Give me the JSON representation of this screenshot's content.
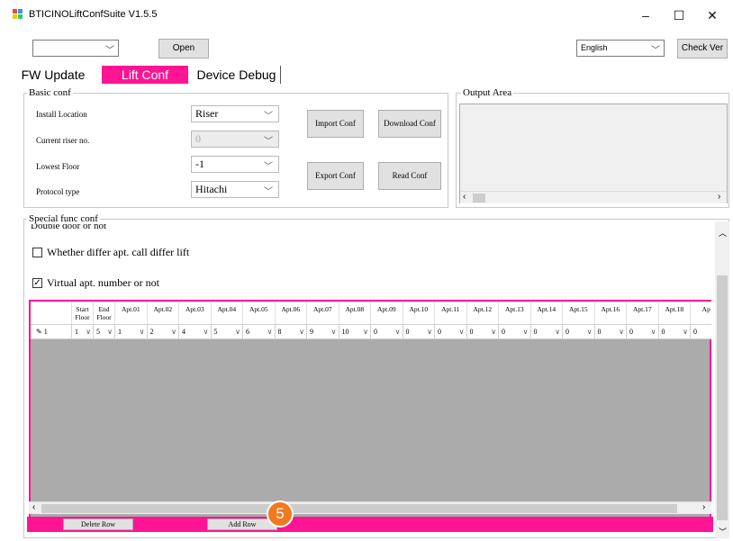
{
  "window": {
    "title": "BTICINOLiftConfSuite V1.5.5",
    "minimize": "–",
    "maximize": "☐",
    "close": "✕"
  },
  "toolbar": {
    "port_value": "",
    "open_label": "Open",
    "language_value": "English",
    "check_ver_label": "Check Ver"
  },
  "tabs": [
    {
      "label": "FW Update"
    },
    {
      "label": "Lift Conf"
    },
    {
      "label": "Device Debug"
    }
  ],
  "basic_conf": {
    "title": "Basic conf",
    "install_location": {
      "label": "Install Location",
      "value": "Riser"
    },
    "current_riser": {
      "label": "Current riser no.",
      "value": "0"
    },
    "lowest_floor": {
      "label": "Lowest Floor",
      "value": "-1"
    },
    "protocol_type": {
      "label": "Protocol type",
      "value": "Hitachi"
    },
    "import_label": "Import Conf",
    "download_label": "Download Conf",
    "export_label": "Export Conf",
    "read_label": "Read Conf"
  },
  "output_area": {
    "title": "Output Area"
  },
  "special_conf": {
    "title": "Special func conf",
    "partial_text": "Double door or not",
    "option1": {
      "label": "Whether differ apt. call differ lift",
      "checked": false
    },
    "option2": {
      "label": "Virtual apt. number or not",
      "checked": true
    }
  },
  "grid": {
    "columns": [
      "",
      "Start Floor",
      "End Floor",
      "Apt.01",
      "Apt.02",
      "Apt.03",
      "Apt.04",
      "Apt.05",
      "Apt.06",
      "Apt.07",
      "Apt.08",
      "Apt.09",
      "Apt.10",
      "Apt.11",
      "Apt.12",
      "Apt.13",
      "Apt.14",
      "Apt.15",
      "Apt.16",
      "Apt.17",
      "Apt.18",
      "Ap"
    ],
    "row": {
      "marker": "✎ 1",
      "values": [
        "1",
        "5",
        "1",
        "2",
        "4",
        "5",
        "6",
        "8",
        "9",
        "10",
        "0",
        "0",
        "0",
        "0",
        "0",
        "0",
        "0",
        "0",
        "0",
        "0",
        "0"
      ]
    }
  },
  "buttons": {
    "delete_row": "Delete Row",
    "add_row": "Add Row"
  },
  "callout": {
    "number": "5",
    "color": "#f07a1e"
  },
  "colors": {
    "accent": "#ff1493",
    "grid_bg": "#ababab"
  }
}
